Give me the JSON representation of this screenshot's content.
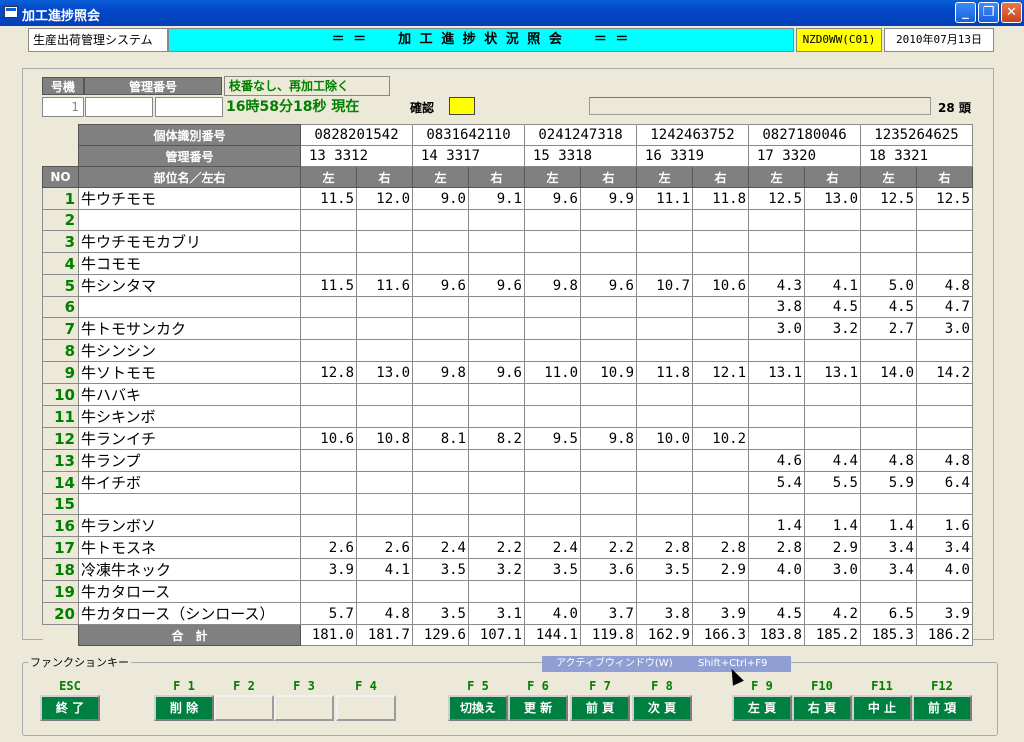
{
  "window": {
    "title": "加工進捗照会"
  },
  "header": {
    "system_name": "生産出荷管理システム",
    "screen_title": "＝ ＝　　加 工 進 捗 状 況 照 会　　＝ ＝",
    "screen_code": "NZD0WW(C01)",
    "date": "2010年07月13日"
  },
  "search": {
    "gouki_label": "号機",
    "kanri_label": "管理番号",
    "note": "枝番なし、再加工除く",
    "gouki_value": "1",
    "kanri_value1": "",
    "kanri_value2": "",
    "time_now": "16時58分18秒 現在",
    "kakunin_label": "確認",
    "count": "28 頭"
  },
  "grid": {
    "id_header": "個体識別番号",
    "mgmt_header": "管理番号",
    "no_header": "NO",
    "part_header": "部位名／左右",
    "left": "左",
    "right": "右",
    "total_label": "合　計",
    "animals": [
      {
        "id": "0828201542",
        "mgmt": "13  3312"
      },
      {
        "id": "0831642110",
        "mgmt": "14  3317"
      },
      {
        "id": "0241247318",
        "mgmt": "15  3318"
      },
      {
        "id": "1242463752",
        "mgmt": "16  3319"
      },
      {
        "id": "0827180046",
        "mgmt": "17  3320"
      },
      {
        "id": "1235264625",
        "mgmt": "18  3321"
      }
    ],
    "rows": [
      {
        "no": "1",
        "part": "牛ウチモモ",
        "v": [
          "11.5",
          "12.0",
          "9.0",
          "9.1",
          "9.6",
          "9.9",
          "11.1",
          "11.8",
          "12.5",
          "13.0",
          "12.5",
          "12.5"
        ]
      },
      {
        "no": "2",
        "part": "",
        "v": [
          "",
          "",
          "",
          "",
          "",
          "",
          "",
          "",
          "",
          "",
          "",
          ""
        ]
      },
      {
        "no": "3",
        "part": "牛ウチモモカブリ",
        "v": [
          "",
          "",
          "",
          "",
          "",
          "",
          "",
          "",
          "",
          "",
          "",
          ""
        ]
      },
      {
        "no": "4",
        "part": "牛コモモ",
        "v": [
          "",
          "",
          "",
          "",
          "",
          "",
          "",
          "",
          "",
          "",
          "",
          ""
        ]
      },
      {
        "no": "5",
        "part": "牛シンタマ",
        "v": [
          "11.5",
          "11.6",
          "9.6",
          "9.6",
          "9.8",
          "9.6",
          "10.7",
          "10.6",
          "4.3",
          "4.1",
          "5.0",
          "4.8"
        ]
      },
      {
        "no": "6",
        "part": "",
        "v": [
          "",
          "",
          "",
          "",
          "",
          "",
          "",
          "",
          "3.8",
          "4.5",
          "4.5",
          "4.7"
        ]
      },
      {
        "no": "7",
        "part": "牛トモサンカク",
        "v": [
          "",
          "",
          "",
          "",
          "",
          "",
          "",
          "",
          "3.0",
          "3.2",
          "2.7",
          "3.0"
        ]
      },
      {
        "no": "8",
        "part": "牛シンシン",
        "v": [
          "",
          "",
          "",
          "",
          "",
          "",
          "",
          "",
          "",
          "",
          "",
          ""
        ]
      },
      {
        "no": "9",
        "part": "牛ソトモモ",
        "v": [
          "12.8",
          "13.0",
          "9.8",
          "9.6",
          "11.0",
          "10.9",
          "11.8",
          "12.1",
          "13.1",
          "13.1",
          "14.0",
          "14.2"
        ]
      },
      {
        "no": "10",
        "part": "牛ハバキ",
        "v": [
          "",
          "",
          "",
          "",
          "",
          "",
          "",
          "",
          "",
          "",
          "",
          ""
        ]
      },
      {
        "no": "11",
        "part": "牛シキンボ",
        "v": [
          "",
          "",
          "",
          "",
          "",
          "",
          "",
          "",
          "",
          "",
          "",
          ""
        ]
      },
      {
        "no": "12",
        "part": "牛ランイチ",
        "v": [
          "10.6",
          "10.8",
          "8.1",
          "8.2",
          "9.5",
          "9.8",
          "10.0",
          "10.2",
          "",
          "",
          "",
          ""
        ]
      },
      {
        "no": "13",
        "part": "牛ランプ",
        "v": [
          "",
          "",
          "",
          "",
          "",
          "",
          "",
          "",
          "4.6",
          "4.4",
          "4.8",
          "4.8"
        ]
      },
      {
        "no": "14",
        "part": "牛イチボ",
        "v": [
          "",
          "",
          "",
          "",
          "",
          "",
          "",
          "",
          "5.4",
          "5.5",
          "5.9",
          "6.4"
        ]
      },
      {
        "no": "15",
        "part": "",
        "v": [
          "",
          "",
          "",
          "",
          "",
          "",
          "",
          "",
          "",
          "",
          "",
          ""
        ]
      },
      {
        "no": "16",
        "part": "牛ランボソ",
        "v": [
          "",
          "",
          "",
          "",
          "",
          "",
          "",
          "",
          "1.4",
          "1.4",
          "1.4",
          "1.6"
        ]
      },
      {
        "no": "17",
        "part": "牛トモスネ",
        "v": [
          "2.6",
          "2.6",
          "2.4",
          "2.2",
          "2.4",
          "2.2",
          "2.8",
          "2.8",
          "2.8",
          "2.9",
          "3.4",
          "3.4"
        ]
      },
      {
        "no": "18",
        "part": "冷凍牛ネック",
        "v": [
          "3.9",
          "4.1",
          "3.5",
          "3.2",
          "3.5",
          "3.6",
          "3.5",
          "2.9",
          "4.0",
          "3.0",
          "3.4",
          "4.0"
        ]
      },
      {
        "no": "19",
        "part": "牛カタロース",
        "v": [
          "",
          "",
          "",
          "",
          "",
          "",
          "",
          "",
          "",
          "",
          "",
          ""
        ]
      },
      {
        "no": "20",
        "part": "牛カタロース（シンロース）",
        "v": [
          "5.7",
          "4.8",
          "3.5",
          "3.1",
          "4.0",
          "3.7",
          "3.8",
          "3.9",
          "4.5",
          "4.2",
          "6.5",
          "3.9"
        ]
      }
    ],
    "totals": [
      "181.0",
      "181.7",
      "129.6",
      "107.1",
      "144.1",
      "119.8",
      "162.9",
      "166.3",
      "183.8",
      "185.2",
      "185.3",
      "186.2"
    ]
  },
  "function_keys": {
    "legend": "ファンクションキー",
    "keys": [
      {
        "key": "ESC",
        "label": "終 了",
        "name": "esc"
      },
      {
        "key": "F 1",
        "label": "削 除",
        "name": "f1"
      },
      {
        "key": "F 2",
        "label": "",
        "name": "f2"
      },
      {
        "key": "F 3",
        "label": "",
        "name": "f3"
      },
      {
        "key": "F 4",
        "label": "",
        "name": "f4"
      },
      {
        "key": "F 5",
        "label": "切換え",
        "name": "f5"
      },
      {
        "key": "F 6",
        "label": "更 新",
        "name": "f6"
      },
      {
        "key": "F 7",
        "label": "前 頁",
        "name": "f7"
      },
      {
        "key": "F 8",
        "label": "次 頁",
        "name": "f8"
      },
      {
        "key": "F 9",
        "label": "左 頁",
        "name": "f9"
      },
      {
        "key": "F10",
        "label": "右 頁",
        "name": "f10"
      },
      {
        "key": "F11",
        "label": "中 止",
        "name": "f11"
      },
      {
        "key": "F12",
        "label": "前 項",
        "name": "f12"
      }
    ]
  },
  "tooltip": {
    "text": "アクティブウィンドウ(W)",
    "shortcut": "Shift+Ctrl+F9"
  }
}
